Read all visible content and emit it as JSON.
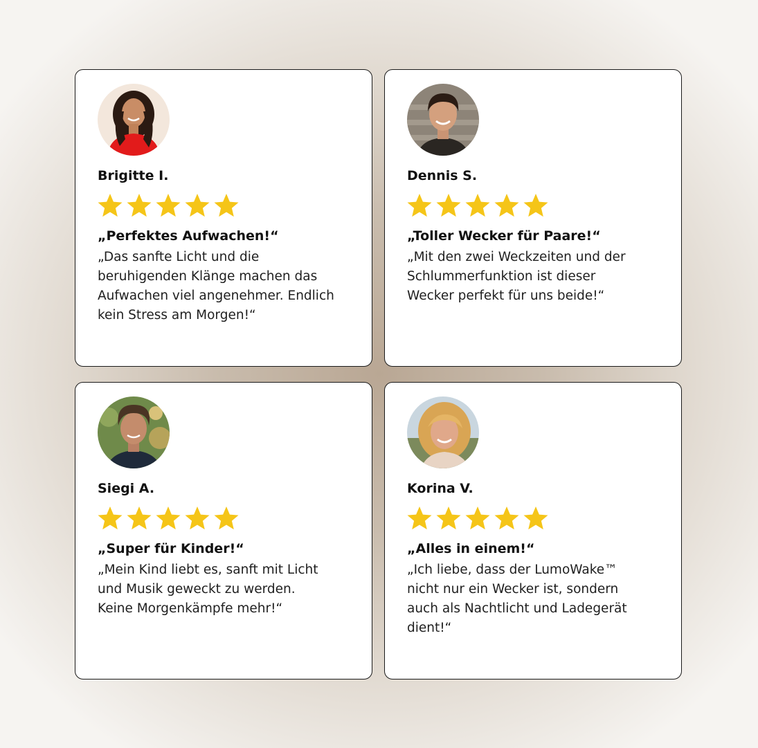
{
  "colors": {
    "star": "#f5c518",
    "card_background": "#ffffff",
    "card_border": "#1a1a1a"
  },
  "reviews": [
    {
      "name": "Brigitte I.",
      "rating": 5,
      "headline": "„Perfektes Aufwachen!“",
      "text": "„Das sanfte Licht und die beruhigenden Klänge machen das Aufwachen viel angenehmer. Endlich kein Stress am Morgen!“",
      "avatar": "woman-red-top-avatar"
    },
    {
      "name": "Dennis S.",
      "rating": 5,
      "headline": "„Toller Wecker für Paare!“",
      "text": "„Mit den zwei Weckzeiten und der Schlummerfunktion ist dieser Wecker perfekt für uns beide!“",
      "avatar": "man-smiling-avatar"
    },
    {
      "name": "Siegi A.",
      "rating": 5,
      "headline": "„Super für Kinder!“",
      "text": "„Mein Kind liebt es, sanft mit Licht und Musik geweckt zu werden. Keine Morgenkämpfe mehr!“",
      "avatar": "man-curly-hair-avatar"
    },
    {
      "name": "Korina V.",
      "rating": 5,
      "headline": "„Alles in einem!“",
      "text": "„Ich liebe, dass der LumoWake™ nicht nur ein Wecker ist, sondern auch als Nachtlicht und Ladegerät dient!“",
      "avatar": "woman-blonde-avatar"
    }
  ]
}
